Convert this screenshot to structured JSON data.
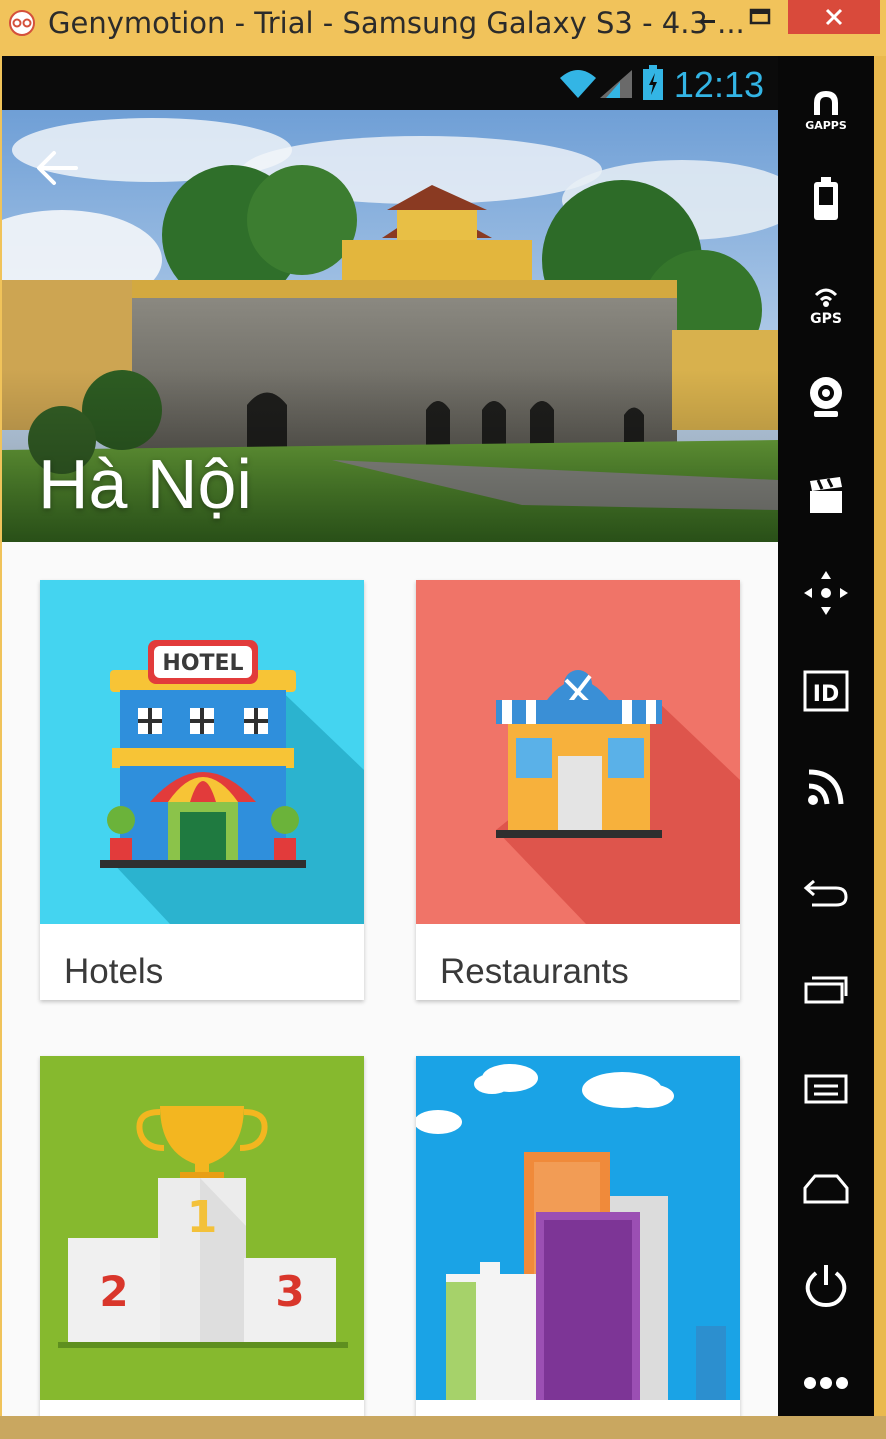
{
  "window": {
    "title": "Genymotion - Trial - Samsung Galaxy S3 - 4.3 ...",
    "minimize_icon": "minimize-icon",
    "maximize_icon": "maximize-icon",
    "close_icon": "close-icon",
    "close_color": "#d94a3b",
    "titlebar_color": "#f1c35b"
  },
  "statusbar": {
    "time": "12:13",
    "icons": [
      "wifi-icon",
      "signal-icon",
      "battery-icon"
    ],
    "accent": "#33b5e5"
  },
  "hero": {
    "title": "Hà Nội",
    "back_icon": "arrow-back-icon"
  },
  "categories": [
    {
      "label": "Hotels",
      "color": "#44d4f0",
      "icon": "hotel-icon"
    },
    {
      "label": "Restaurants",
      "color": "#f07468",
      "icon": "restaurant-icon"
    },
    {
      "label": "",
      "color": "#86b92e",
      "icon": "trophy-podium-icon"
    },
    {
      "label": "",
      "color": "#1aa3e6",
      "icon": "city-buildings-icon"
    }
  ],
  "sidebar": {
    "items": [
      {
        "icon": "gapps-icon",
        "label": "GAPPS"
      },
      {
        "icon": "battery-icon",
        "label": ""
      },
      {
        "icon": "gps-icon",
        "label": "GPS"
      },
      {
        "icon": "webcam-icon",
        "label": ""
      },
      {
        "icon": "clapper-icon",
        "label": ""
      },
      {
        "icon": "dpad-icon",
        "label": ""
      },
      {
        "icon": "id-icon",
        "label": "ID"
      },
      {
        "icon": "cast-icon",
        "label": ""
      },
      {
        "icon": "back-icon",
        "label": ""
      },
      {
        "icon": "recent-apps-icon",
        "label": ""
      },
      {
        "icon": "menu-icon",
        "label": ""
      },
      {
        "icon": "home-icon",
        "label": ""
      },
      {
        "icon": "power-icon",
        "label": ""
      },
      {
        "icon": "more-icon",
        "label": ""
      }
    ]
  }
}
